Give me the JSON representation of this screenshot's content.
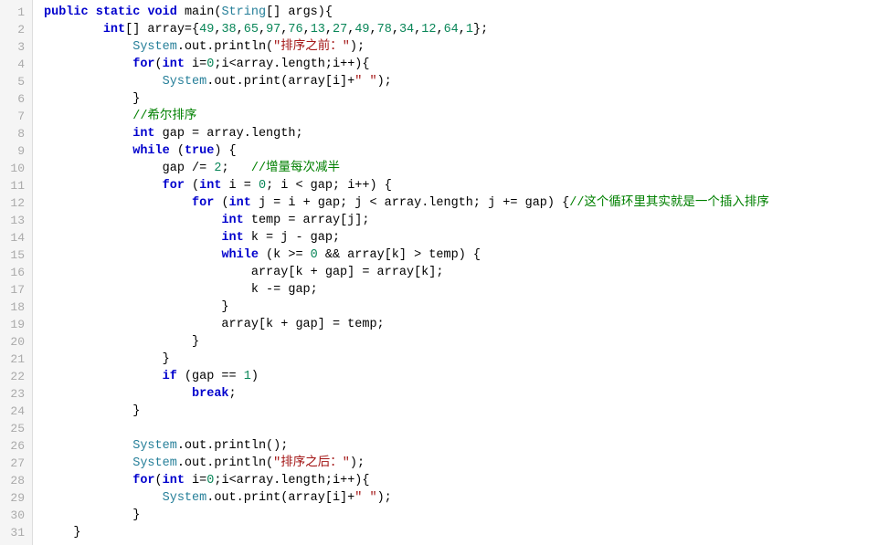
{
  "editor": {
    "lines": [
      {
        "num": 1,
        "tokens": [
          {
            "t": "kw",
            "v": "public"
          },
          {
            "t": "plain",
            "v": " "
          },
          {
            "t": "kw",
            "v": "static"
          },
          {
            "t": "plain",
            "v": " "
          },
          {
            "t": "kw",
            "v": "void"
          },
          {
            "t": "plain",
            "v": " main("
          },
          {
            "t": "cls",
            "v": "String"
          },
          {
            "t": "plain",
            "v": "[] args){"
          }
        ]
      },
      {
        "num": 2,
        "tokens": [
          {
            "t": "plain",
            "v": "        "
          },
          {
            "t": "kw",
            "v": "int"
          },
          {
            "t": "plain",
            "v": "[] array={"
          },
          {
            "t": "num",
            "v": "49"
          },
          {
            "t": "plain",
            "v": ","
          },
          {
            "t": "num",
            "v": "38"
          },
          {
            "t": "plain",
            "v": ","
          },
          {
            "t": "num",
            "v": "65"
          },
          {
            "t": "plain",
            "v": ","
          },
          {
            "t": "num",
            "v": "97"
          },
          {
            "t": "plain",
            "v": ","
          },
          {
            "t": "num",
            "v": "76"
          },
          {
            "t": "plain",
            "v": ","
          },
          {
            "t": "num",
            "v": "13"
          },
          {
            "t": "plain",
            "v": ","
          },
          {
            "t": "num",
            "v": "27"
          },
          {
            "t": "plain",
            "v": ","
          },
          {
            "t": "num",
            "v": "49"
          },
          {
            "t": "plain",
            "v": ","
          },
          {
            "t": "num",
            "v": "78"
          },
          {
            "t": "plain",
            "v": ","
          },
          {
            "t": "num",
            "v": "34"
          },
          {
            "t": "plain",
            "v": ","
          },
          {
            "t": "num",
            "v": "12"
          },
          {
            "t": "plain",
            "v": ","
          },
          {
            "t": "num",
            "v": "64"
          },
          {
            "t": "plain",
            "v": ","
          },
          {
            "t": "num",
            "v": "1"
          },
          {
            "t": "plain",
            "v": "};"
          }
        ]
      },
      {
        "num": 3,
        "tokens": [
          {
            "t": "plain",
            "v": "            "
          },
          {
            "t": "cls",
            "v": "System"
          },
          {
            "t": "plain",
            "v": ".out.println("
          },
          {
            "t": "str",
            "v": "\"排序之前：\""
          },
          {
            "t": "plain",
            "v": ");"
          }
        ]
      },
      {
        "num": 4,
        "tokens": [
          {
            "t": "plain",
            "v": "            "
          },
          {
            "t": "kw",
            "v": "for"
          },
          {
            "t": "plain",
            "v": "("
          },
          {
            "t": "kw",
            "v": "int"
          },
          {
            "t": "plain",
            "v": " i="
          },
          {
            "t": "num",
            "v": "0"
          },
          {
            "t": "plain",
            "v": ";i<array.length;i++){"
          }
        ]
      },
      {
        "num": 5,
        "tokens": [
          {
            "t": "plain",
            "v": "                "
          },
          {
            "t": "cls",
            "v": "System"
          },
          {
            "t": "plain",
            "v": ".out.print(array[i]+"
          },
          {
            "t": "str",
            "v": "\" \""
          },
          {
            "t": "plain",
            "v": ");"
          }
        ]
      },
      {
        "num": 6,
        "tokens": [
          {
            "t": "plain",
            "v": "            }"
          }
        ]
      },
      {
        "num": 7,
        "tokens": [
          {
            "t": "plain",
            "v": "            "
          },
          {
            "t": "comment",
            "v": "//希尔排序"
          }
        ]
      },
      {
        "num": 8,
        "tokens": [
          {
            "t": "plain",
            "v": "            "
          },
          {
            "t": "kw",
            "v": "int"
          },
          {
            "t": "plain",
            "v": " gap = array.length;"
          }
        ]
      },
      {
        "num": 9,
        "tokens": [
          {
            "t": "plain",
            "v": "            "
          },
          {
            "t": "kw",
            "v": "while"
          },
          {
            "t": "plain",
            "v": " ("
          },
          {
            "t": "kw",
            "v": "true"
          },
          {
            "t": "plain",
            "v": ") {"
          }
        ]
      },
      {
        "num": 10,
        "tokens": [
          {
            "t": "plain",
            "v": "                gap /= "
          },
          {
            "t": "num",
            "v": "2"
          },
          {
            "t": "plain",
            "v": ";   "
          },
          {
            "t": "comment",
            "v": "//增量每次减半"
          }
        ]
      },
      {
        "num": 11,
        "tokens": [
          {
            "t": "plain",
            "v": "                "
          },
          {
            "t": "kw",
            "v": "for"
          },
          {
            "t": "plain",
            "v": " ("
          },
          {
            "t": "kw",
            "v": "int"
          },
          {
            "t": "plain",
            "v": " i = "
          },
          {
            "t": "num",
            "v": "0"
          },
          {
            "t": "plain",
            "v": "; i < gap; i++) {"
          }
        ]
      },
      {
        "num": 12,
        "tokens": [
          {
            "t": "plain",
            "v": "                    "
          },
          {
            "t": "kw",
            "v": "for"
          },
          {
            "t": "plain",
            "v": " ("
          },
          {
            "t": "kw",
            "v": "int"
          },
          {
            "t": "plain",
            "v": " j = i + gap; j < array.length; j += gap) {"
          },
          {
            "t": "comment",
            "v": "//这个循环里其实就是一个插入排序"
          }
        ]
      },
      {
        "num": 13,
        "tokens": [
          {
            "t": "plain",
            "v": "                        "
          },
          {
            "t": "kw",
            "v": "int"
          },
          {
            "t": "plain",
            "v": " temp = array[j];"
          }
        ]
      },
      {
        "num": 14,
        "tokens": [
          {
            "t": "plain",
            "v": "                        "
          },
          {
            "t": "kw",
            "v": "int"
          },
          {
            "t": "plain",
            "v": " k = j - gap;"
          }
        ]
      },
      {
        "num": 15,
        "tokens": [
          {
            "t": "plain",
            "v": "                        "
          },
          {
            "t": "kw",
            "v": "while"
          },
          {
            "t": "plain",
            "v": " (k >= "
          },
          {
            "t": "num",
            "v": "0"
          },
          {
            "t": "plain",
            "v": " && array[k] > temp) {"
          }
        ]
      },
      {
        "num": 16,
        "tokens": [
          {
            "t": "plain",
            "v": "                            array[k + gap] = array[k];"
          }
        ]
      },
      {
        "num": 17,
        "tokens": [
          {
            "t": "plain",
            "v": "                            k -= gap;"
          }
        ]
      },
      {
        "num": 18,
        "tokens": [
          {
            "t": "plain",
            "v": "                        }"
          }
        ]
      },
      {
        "num": 19,
        "tokens": [
          {
            "t": "plain",
            "v": "                        array[k + gap] = temp;"
          }
        ]
      },
      {
        "num": 20,
        "tokens": [
          {
            "t": "plain",
            "v": "                    }"
          }
        ]
      },
      {
        "num": 21,
        "tokens": [
          {
            "t": "plain",
            "v": "                }"
          }
        ]
      },
      {
        "num": 22,
        "tokens": [
          {
            "t": "plain",
            "v": "                "
          },
          {
            "t": "kw",
            "v": "if"
          },
          {
            "t": "plain",
            "v": " (gap == "
          },
          {
            "t": "num",
            "v": "1"
          },
          {
            "t": "plain",
            "v": ")"
          }
        ]
      },
      {
        "num": 23,
        "tokens": [
          {
            "t": "plain",
            "v": "                    "
          },
          {
            "t": "kw",
            "v": "break"
          },
          {
            "t": "plain",
            "v": ";"
          }
        ]
      },
      {
        "num": 24,
        "tokens": [
          {
            "t": "plain",
            "v": "            }"
          }
        ]
      },
      {
        "num": 25,
        "tokens": [
          {
            "t": "plain",
            "v": ""
          }
        ]
      },
      {
        "num": 26,
        "tokens": [
          {
            "t": "plain",
            "v": "            "
          },
          {
            "t": "cls",
            "v": "System"
          },
          {
            "t": "plain",
            "v": ".out.println();"
          }
        ]
      },
      {
        "num": 27,
        "tokens": [
          {
            "t": "plain",
            "v": "            "
          },
          {
            "t": "cls",
            "v": "System"
          },
          {
            "t": "plain",
            "v": ".out.println("
          },
          {
            "t": "str",
            "v": "\"排序之后：\""
          },
          {
            "t": "plain",
            "v": ");"
          }
        ]
      },
      {
        "num": 28,
        "tokens": [
          {
            "t": "plain",
            "v": "            "
          },
          {
            "t": "kw",
            "v": "for"
          },
          {
            "t": "plain",
            "v": "("
          },
          {
            "t": "kw",
            "v": "int"
          },
          {
            "t": "plain",
            "v": " i="
          },
          {
            "t": "num",
            "v": "0"
          },
          {
            "t": "plain",
            "v": ";i<array.length;i++){"
          }
        ]
      },
      {
        "num": 29,
        "tokens": [
          {
            "t": "plain",
            "v": "                "
          },
          {
            "t": "cls",
            "v": "System"
          },
          {
            "t": "plain",
            "v": ".out.print(array[i]+"
          },
          {
            "t": "str",
            "v": "\" \""
          },
          {
            "t": "plain",
            "v": ");"
          }
        ]
      },
      {
        "num": 30,
        "tokens": [
          {
            "t": "plain",
            "v": "            }"
          }
        ]
      },
      {
        "num": 31,
        "tokens": [
          {
            "t": "plain",
            "v": "    }"
          }
        ]
      }
    ]
  }
}
